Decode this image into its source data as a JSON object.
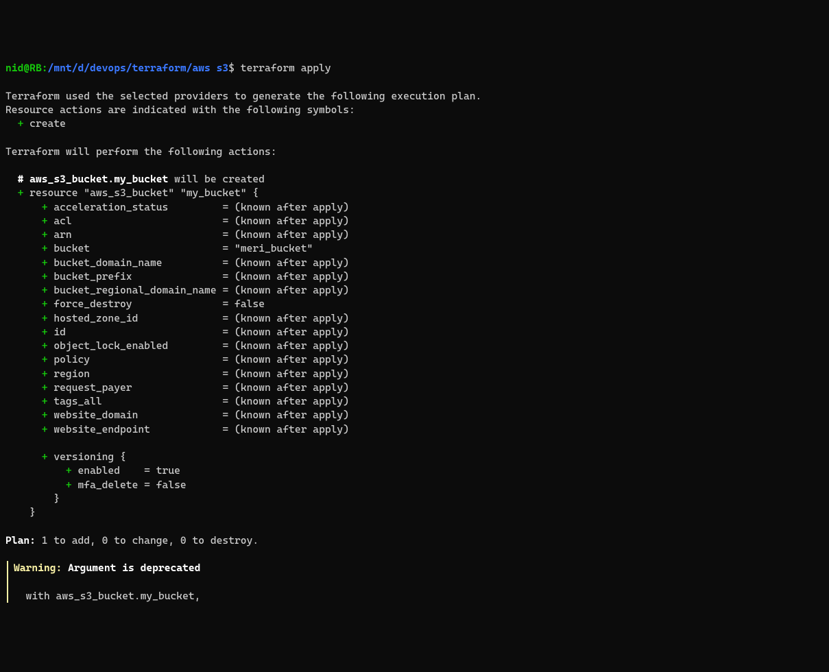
{
  "prompt": {
    "user_host": "nid@RB",
    "separator": ":",
    "path": "/mnt/d/devops/terraform/aws s3",
    "symbol": "$",
    "command": "terraform apply"
  },
  "intro": {
    "line1": "Terraform used the selected providers to generate the following execution plan.",
    "line2": "Resource actions are indicated with the following symbols:",
    "create_symbol": "+",
    "create_label": "create"
  },
  "actions_header": "Terraform will perform the following actions:",
  "resource": {
    "comment_prefix": "#",
    "comment_name": "aws_s3_bucket.my_bucket",
    "comment_suffix": " will be created",
    "plus": "+",
    "decl": "resource \"aws_s3_bucket\" \"my_bucket\" {",
    "attrs": [
      {
        "name": "acceleration_status",
        "value": "(known after apply)"
      },
      {
        "name": "acl",
        "value": "(known after apply)"
      },
      {
        "name": "arn",
        "value": "(known after apply)"
      },
      {
        "name": "bucket",
        "value": "\"meri_bucket\""
      },
      {
        "name": "bucket_domain_name",
        "value": "(known after apply)"
      },
      {
        "name": "bucket_prefix",
        "value": "(known after apply)"
      },
      {
        "name": "bucket_regional_domain_name",
        "value": "(known after apply)"
      },
      {
        "name": "force_destroy",
        "value": "false"
      },
      {
        "name": "hosted_zone_id",
        "value": "(known after apply)"
      },
      {
        "name": "id",
        "value": "(known after apply)"
      },
      {
        "name": "object_lock_enabled",
        "value": "(known after apply)"
      },
      {
        "name": "policy",
        "value": "(known after apply)"
      },
      {
        "name": "region",
        "value": "(known after apply)"
      },
      {
        "name": "request_payer",
        "value": "(known after apply)"
      },
      {
        "name": "tags_all",
        "value": "(known after apply)"
      },
      {
        "name": "website_domain",
        "value": "(known after apply)"
      },
      {
        "name": "website_endpoint",
        "value": "(known after apply)"
      }
    ],
    "block": {
      "name": "versioning {",
      "attrs": [
        {
          "name": "enabled",
          "value": "true"
        },
        {
          "name": "mfa_delete",
          "value": "false"
        }
      ],
      "close": "}"
    },
    "close": "}"
  },
  "plan": {
    "label": "Plan:",
    "text": " 1 to add, 0 to change, 0 to destroy."
  },
  "warning": {
    "label": "Warning:",
    "text": " Argument is deprecated",
    "detail": "with aws_s3_bucket.my_bucket,"
  }
}
